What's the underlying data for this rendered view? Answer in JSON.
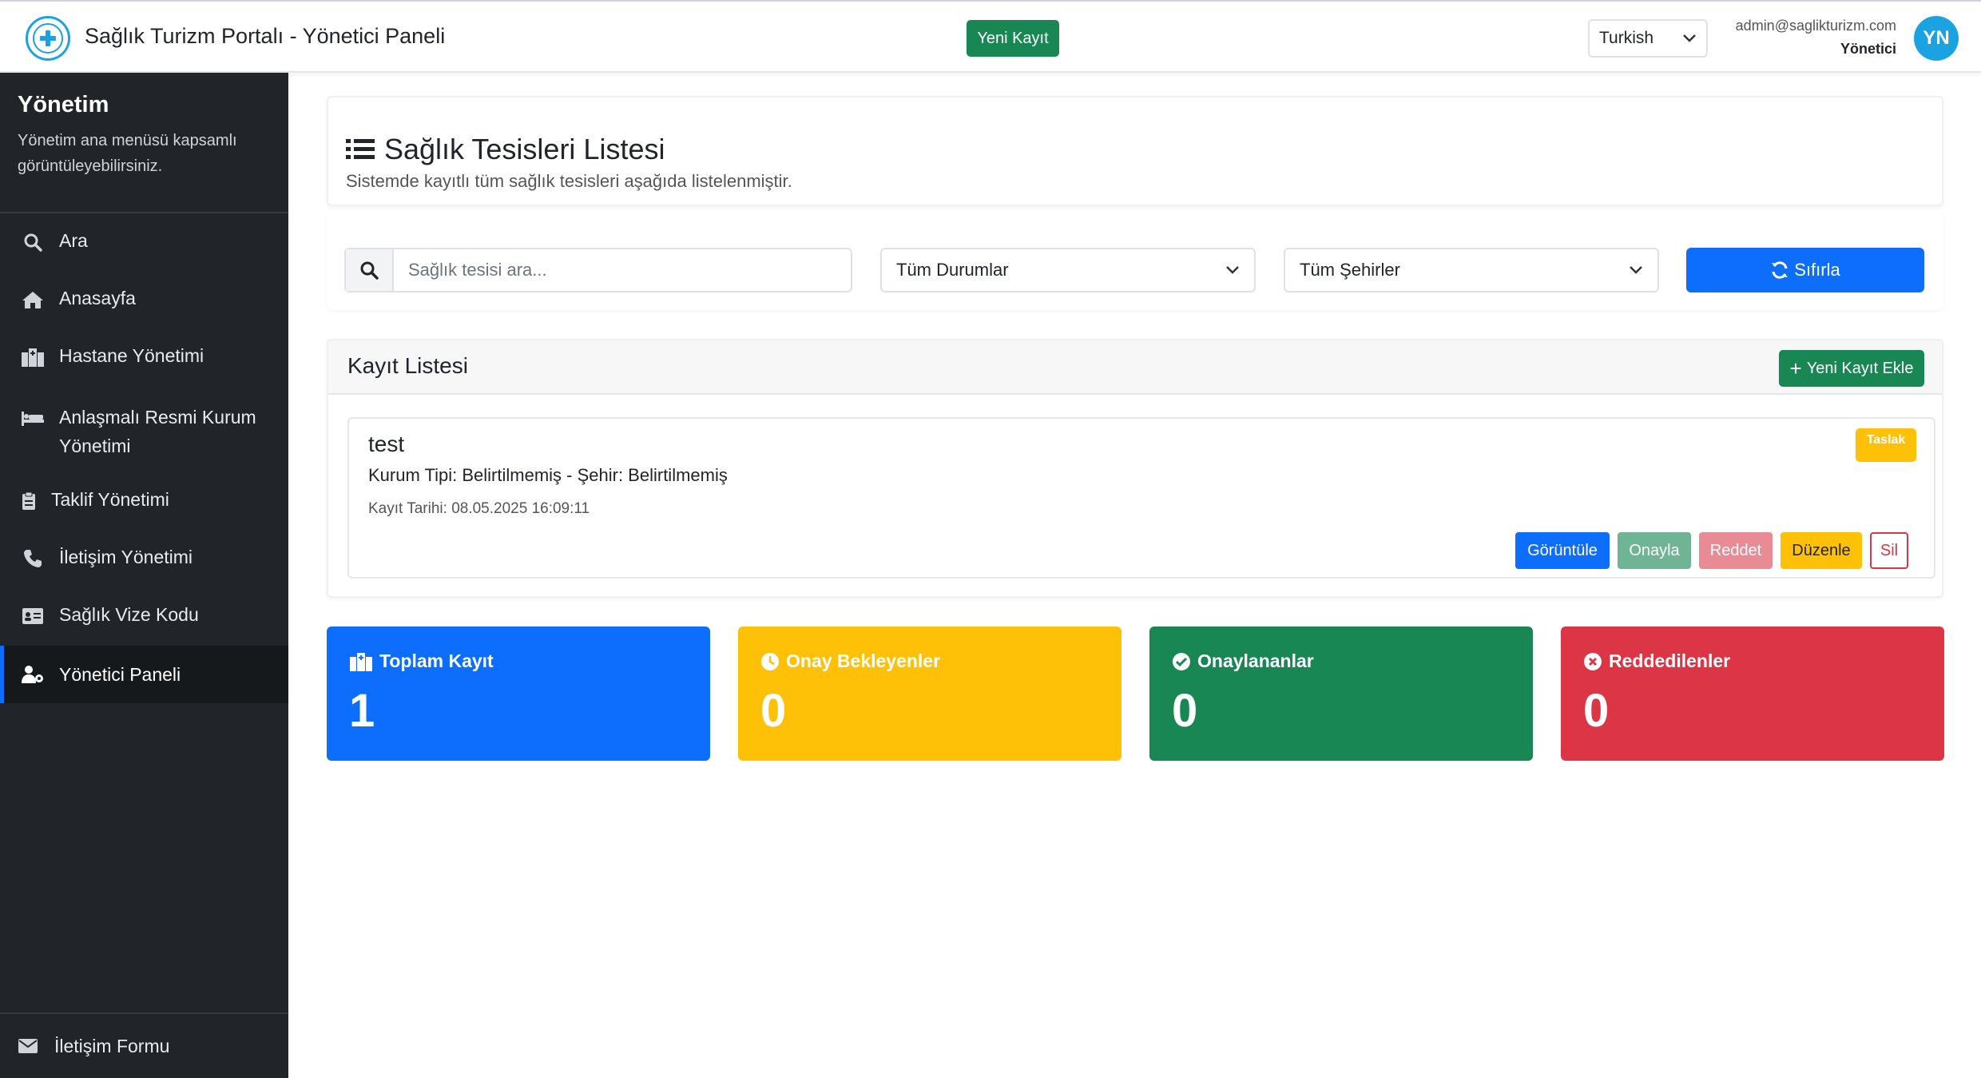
{
  "header": {
    "app_title": "Sağlık Turizm Portalı - Yönetici Paneli",
    "new_record_label": "Yeni Kayıt",
    "language": "Turkish",
    "user_email": "admin@saglikturizm.com",
    "user_role": "Yönetici",
    "avatar_initials": "YN"
  },
  "sidebar": {
    "title": "Yönetim",
    "description": "Yönetim ana menüsü kapsamlı görüntüleyebilirsiniz.",
    "items": [
      {
        "label": "Ara",
        "icon": "search-icon"
      },
      {
        "label": "Anasayfa",
        "icon": "home-icon"
      },
      {
        "label": "Hastane Yönetimi",
        "icon": "hospital-icon"
      },
      {
        "label": "Anlaşmalı Resmi Kurum Yönetimi",
        "icon": "institution-icon"
      },
      {
        "label": "Taklif Yönetimi",
        "icon": "clipboard-icon"
      },
      {
        "label": "İletişim Yönetimi",
        "icon": "phone-icon"
      },
      {
        "label": "Sağlık Vize Kodu",
        "icon": "id-card-icon"
      },
      {
        "label": "Yönetici Paneli",
        "icon": "user-gear-icon",
        "active": true
      }
    ],
    "footer_label": "İletişim Formu"
  },
  "page": {
    "title": "Sağlık Tesisleri Listesi",
    "subtitle": "Sistemde kayıtlı tüm sağlık tesisleri aşağıda listelenmiştir."
  },
  "filters": {
    "search_placeholder": "Sağlık tesisi ara...",
    "status_selected": "Tüm Durumlar",
    "city_selected": "Tüm Şehirler",
    "reset_label": "Sıfırla"
  },
  "list": {
    "title": "Kayıt Listesi",
    "add_label": "Yeni Kayıt Ekle",
    "records": [
      {
        "name": "test",
        "info": "Kurum Tipi: Belirtilmemiş - Şehir: Belirtilmemiş",
        "date": "Kayıt Tarihi: 08.05.2025 16:09:11",
        "status": "Taslak",
        "actions": {
          "view": "Görüntüle",
          "approve": "Onayla",
          "reject": "Reddet",
          "edit": "Düzenle",
          "delete": "Sil"
        }
      }
    ]
  },
  "stats": [
    {
      "label": "Toplam Kayıt",
      "value": "1",
      "color": "#0d6efd",
      "icon": "hospital-icon"
    },
    {
      "label": "Onay Bekleyenler",
      "value": "0",
      "color": "#ffc107",
      "icon": "clock-icon"
    },
    {
      "label": "Onaylananlar",
      "value": "0",
      "color": "#198754",
      "icon": "check-circle-icon"
    },
    {
      "label": "Reddedilenler",
      "value": "0",
      "color": "#dc3545",
      "icon": "x-circle-icon"
    }
  ]
}
